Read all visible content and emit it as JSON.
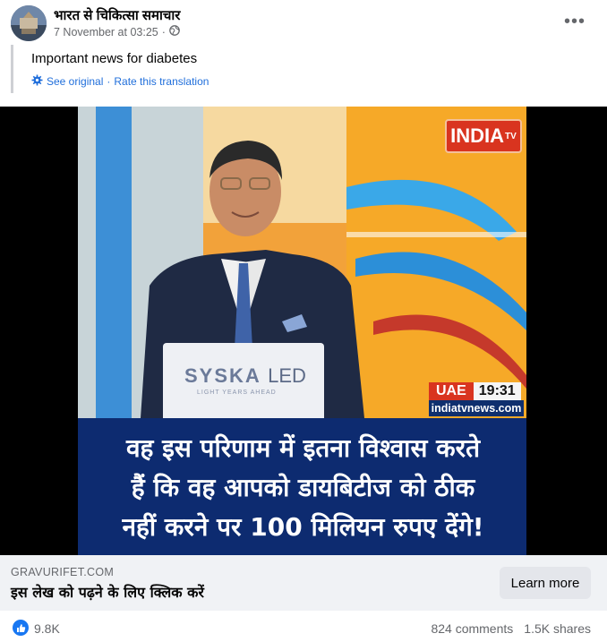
{
  "post": {
    "page_name": "भारत से चिकित्सा समाचार",
    "timestamp": "7 November at 03:25",
    "separator": "·",
    "privacy_icon": "globe-icon",
    "more_icon": "more-dots-icon",
    "more_label": "•••"
  },
  "translation": {
    "text": "Important news for diabetes",
    "see_original": "See original",
    "dot": "·",
    "rate": "Rate this translation",
    "icon": "gear-icon"
  },
  "video": {
    "channel_logo": "INDIA",
    "channel_logo_suffix": "TV",
    "region": "UAE",
    "clock": "19:31",
    "website": "indiatvnews.com",
    "desk_brand": "SYSKA",
    "desk_brand_suffix": "LED",
    "desk_tagline": "LIGHT YEARS AHEAD",
    "caption_lines": [
      "वह इस परिणाम में इतना विश्वास करते",
      "हैं कि वह आपको डायबिटीज को ठीक",
      "नहीं करने पर 100 मिलियन रुपए देंगे!"
    ]
  },
  "link_preview": {
    "domain": "GRAVURIFET.COM",
    "title": "इस लेख को पढ़ने के लिए क्लिक करें",
    "cta": "Learn more"
  },
  "stats": {
    "reaction_icon": "like-icon",
    "reactions": "9.8K",
    "comments": "824 comments",
    "shares": "1.5K shares"
  },
  "colors": {
    "link_blue": "#216fdb",
    "like_blue": "#1877f2",
    "caption_bg": "#0d2b70",
    "channel_red": "#d9341f"
  }
}
